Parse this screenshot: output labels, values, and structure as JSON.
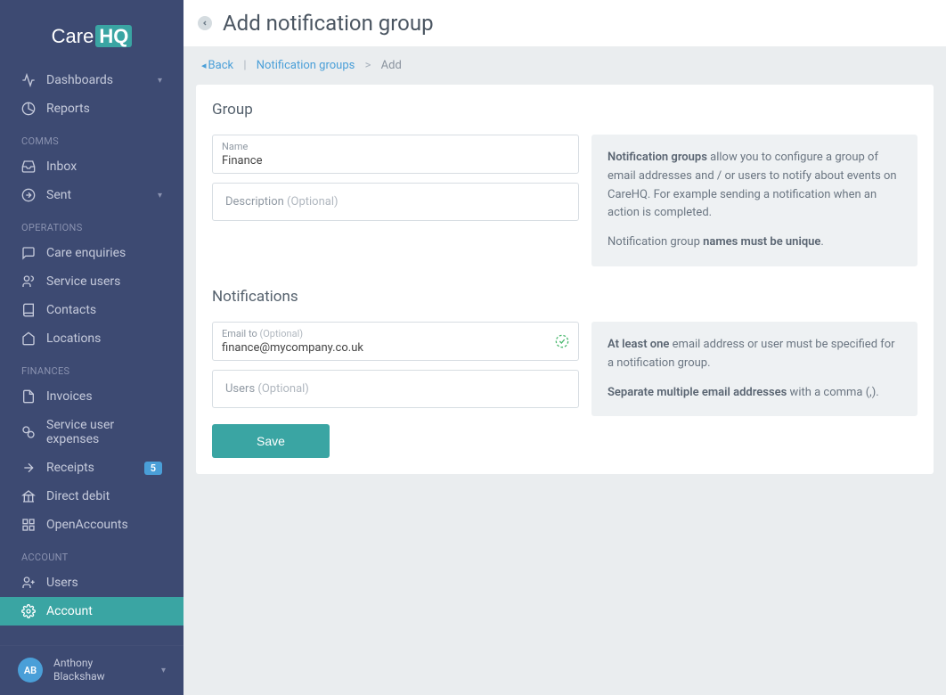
{
  "brand": {
    "name": "Care",
    "suffix": "HQ"
  },
  "sidebar": {
    "sections": [
      {
        "header": null,
        "items": [
          {
            "icon": "activity",
            "label": "Dashboards",
            "chevron": true
          },
          {
            "icon": "pie",
            "label": "Reports"
          }
        ]
      },
      {
        "header": "COMMS",
        "items": [
          {
            "icon": "inbox",
            "label": "Inbox"
          },
          {
            "icon": "send",
            "label": "Sent",
            "chevron": true
          }
        ]
      },
      {
        "header": "OPERATIONS",
        "items": [
          {
            "icon": "message",
            "label": "Care enquiries"
          },
          {
            "icon": "users",
            "label": "Service users"
          },
          {
            "icon": "book",
            "label": "Contacts"
          },
          {
            "icon": "home",
            "label": "Locations"
          }
        ]
      },
      {
        "header": "FINANCES",
        "items": [
          {
            "icon": "file",
            "label": "Invoices"
          },
          {
            "icon": "coins",
            "label": "Service user expenses"
          },
          {
            "icon": "receipt",
            "label": "Receipts",
            "badge": "5"
          },
          {
            "icon": "bank",
            "label": "Direct debit"
          },
          {
            "icon": "grid",
            "label": "OpenAccounts"
          }
        ]
      },
      {
        "header": "ACCOUNT",
        "items": [
          {
            "icon": "user-plus",
            "label": "Users"
          },
          {
            "icon": "gear",
            "label": "Account",
            "active": true
          }
        ]
      }
    ]
  },
  "user": {
    "initials": "AB",
    "name_first": "Anthony",
    "name_last": "Blackshaw"
  },
  "header": {
    "title": "Add notification group"
  },
  "breadcrumb": {
    "back": "Back",
    "link1": "Notification groups",
    "current": "Add"
  },
  "group_section": {
    "title": "Group",
    "name_label": "Name",
    "name_value": "Finance",
    "desc_label": "Description ",
    "desc_opt": "(Optional)",
    "info1_strong": "Notification groups",
    "info1_rest": " allow you to configure a group of email addresses and / or users to notify about events on CareHQ. For example sending a notification when an action is completed.",
    "info2_pre": "Notification group ",
    "info2_strong": "names must be unique",
    "info2_post": "."
  },
  "notif_section": {
    "title": "Notifications",
    "email_label": "Email to ",
    "email_opt": "(Optional)",
    "email_value": "finance@mycompany.co.uk",
    "users_label": "Users ",
    "users_opt": "(Optional)",
    "info1_strong": "At least one",
    "info1_rest": " email address or user must be specified for a notification group.",
    "info2_strong": "Separate multiple email addresses",
    "info2_rest": " with a comma (,)."
  },
  "actions": {
    "save": "Save"
  }
}
